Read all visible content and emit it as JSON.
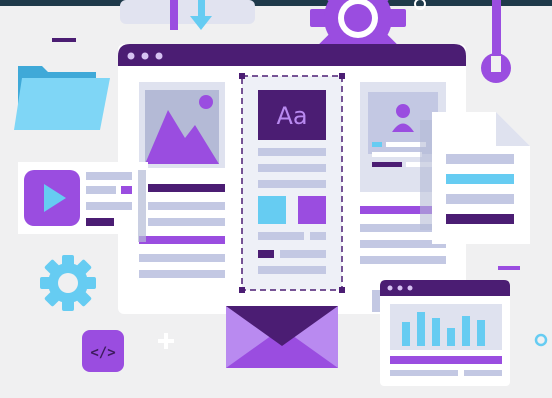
{
  "scene": {
    "description_free": true
  },
  "mockup": {
    "font_sample_label": "Aa",
    "code_tag_label": "</>"
  },
  "palette": {
    "background": "#f0f0f1",
    "dark_purple": "#3d1b5e",
    "deep_purple": "#4b1d73",
    "purple": "#9a4de0",
    "light_purple": "#b98af0",
    "light_blue": "#66ccf2",
    "lavender": "#c3c8e3",
    "panel": "#ffffff",
    "slate": "#b4bad6"
  },
  "icons": [
    "folder-icon",
    "gear-icon",
    "wrench-icon",
    "play-icon",
    "image-icon",
    "user-icon",
    "envelope-icon",
    "code-icon",
    "bar-chart-icon",
    "document-icon",
    "download-arrow-icon",
    "plus-icon",
    "ring-icon"
  ]
}
